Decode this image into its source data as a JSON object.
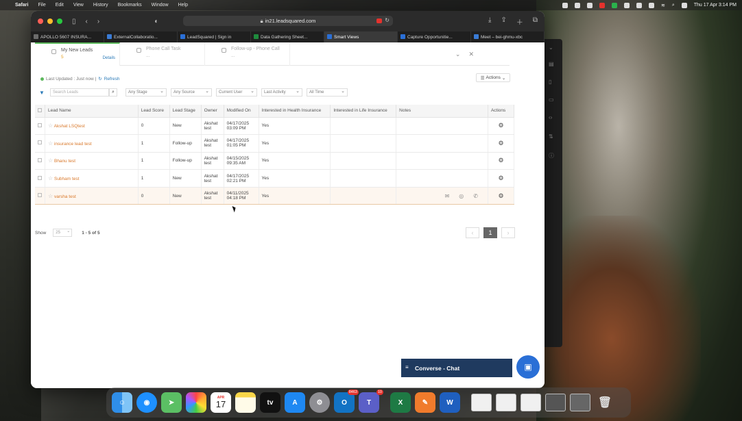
{
  "menubar": {
    "app": "Safari",
    "items": [
      "File",
      "Edit",
      "View",
      "History",
      "Bookmarks",
      "Window",
      "Help"
    ],
    "datetime": "Thu 17 Apr  3:14 PM"
  },
  "browser": {
    "url": "in21.leadsquared.com",
    "tabs": [
      {
        "label": "APOLLO 5607 INSURA...",
        "color": "#6b6b6b"
      },
      {
        "label": "ExternalCollaboratio...",
        "color": "#3a7bd5"
      },
      {
        "label": "LeadSquared | Sign in",
        "color": "#2a6fd6"
      },
      {
        "label": "Data Gathering Sheet...",
        "color": "#1e8a3c"
      },
      {
        "label": "Smart Views",
        "color": "#2a6fd6",
        "active": true
      },
      {
        "label": "Capture Opportunitie...",
        "color": "#2a6fd6"
      },
      {
        "label": "Meet – bei-ghmu-xbc",
        "color": "#3a7bd5"
      }
    ]
  },
  "view_tabs": {
    "my_new_leads": {
      "label": "My New Leads",
      "count": "5",
      "details": "Details"
    },
    "phone_call_task": {
      "label": "Phone Call Task",
      "count": "..."
    },
    "followup_phone_call": {
      "label": "Follow-up - Phone Call",
      "count": "..."
    }
  },
  "status": {
    "last_updated": "Last Updated : Just now |",
    "refresh": "Refresh",
    "actions": "Actions"
  },
  "filters": {
    "search_placeholder": "Search Leads",
    "stage": "Any Stage",
    "source": "Any Source",
    "user": "Current User",
    "activity": "Last Activity",
    "time": "All Time"
  },
  "table": {
    "headers": [
      "Lead Name",
      "Lead Score",
      "Lead Stage",
      "Owner",
      "Modified On",
      "Interested in Health Insurance",
      "Interested in Life Insurance",
      "Notes",
      "Actions"
    ],
    "rows": [
      {
        "name": "Akshat LSQtest",
        "score": "0",
        "stage": "New",
        "owner": "Akshat test",
        "date": "04/17/2025",
        "time": "03:09 PM",
        "health": "Yes"
      },
      {
        "name": "insurance lead test",
        "score": "1",
        "stage": "Follow-up",
        "owner": "Akshat test",
        "date": "04/17/2025",
        "time": "01:05 PM",
        "health": "Yes"
      },
      {
        "name": "Bhanu test",
        "score": "1",
        "stage": "Follow-up",
        "owner": "Akshat test",
        "date": "04/15/2025",
        "time": "09:35 AM",
        "health": "Yes"
      },
      {
        "name": "Subham test",
        "score": "1",
        "stage": "New",
        "owner": "Akshat test",
        "date": "04/17/2025",
        "time": "02:21 PM",
        "health": "Yes"
      },
      {
        "name": "varsha test",
        "score": "0",
        "stage": "New",
        "owner": "Akshat test",
        "date": "04/11/2025",
        "time": "04:18 PM",
        "health": "Yes"
      }
    ]
  },
  "pager": {
    "show_label": "Show",
    "page_size": "25",
    "range": "1 - 5 of 5",
    "current_page": "1"
  },
  "chat": {
    "label": "Converse - Chat"
  },
  "dock": {
    "calendar_day": "17",
    "calendar_month": "APR",
    "tv_label": "tv",
    "outlook_badge": "8463",
    "teams_badge": "10"
  }
}
